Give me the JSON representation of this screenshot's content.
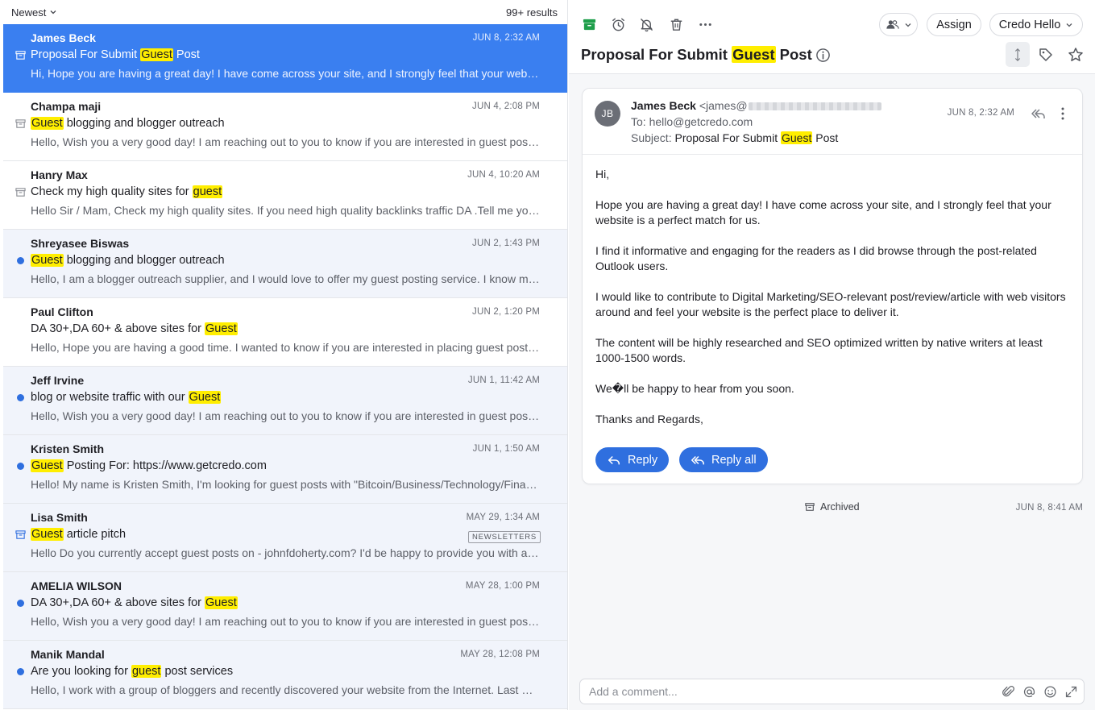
{
  "list": {
    "sort_label": "Newest",
    "results_label": "99+ results",
    "rows": [
      {
        "sender": "James Beck",
        "date": "JUN 8, 2:32 AM",
        "subject_pre": "Proposal For Submit ",
        "subject_hl": "Guest",
        "subject_post": " Post",
        "preview": "Hi, Hope you are having a great day! I have come across your site, and I strongly feel that your website is a perfect match for us.",
        "state": "selected",
        "marker": "archive"
      },
      {
        "sender": "Champa maji",
        "date": "JUN 4, 2:08 PM",
        "subject_pre": "",
        "subject_hl": "Guest",
        "subject_post": " blogging and blogger outreach",
        "preview": "Hello, Wish you a very good day! I am reaching out to you to know if you are interested in guest posting.",
        "state": "read",
        "marker": "archive"
      },
      {
        "sender": "Hanry Max",
        "date": "JUN 4, 10:20 AM",
        "subject_pre": "Check my high quality sites for ",
        "subject_hl": "guest",
        "subject_post": "",
        "preview": "Hello Sir / Mam, Check my high quality sites. If you need high quality backlinks traffic DA .Tell me your budget.",
        "state": "read",
        "marker": "archive"
      },
      {
        "sender": "Shreyasee Biswas",
        "date": "JUN 2, 1:43 PM",
        "subject_pre": "",
        "subject_hl": "Guest",
        "subject_post": " blogging and blogger outreach",
        "preview": "Hello, I am a blogger outreach supplier, and I would love to offer my guest posting service. I know many bloggers.",
        "state": "unread",
        "marker": "dot"
      },
      {
        "sender": "Paul Clifton",
        "date": "JUN 2, 1:20 PM",
        "subject_pre": "DA 30+,DA 60+ & above sites for ",
        "subject_hl": "Guest",
        "subject_post": "",
        "preview": "Hello, Hope you are having a good time. I wanted to know if you are interested in placing guest posts on sites.",
        "state": "read",
        "marker": "none"
      },
      {
        "sender": "Jeff Irvine",
        "date": "JUN 1, 11:42 AM",
        "subject_pre": "blog or website traffic with our ",
        "subject_hl": "Guest",
        "subject_post": "",
        "preview": "Hello, Wish you a very good day! I am reaching out to you to know if you are interested in guest posting.",
        "state": "unread",
        "marker": "dot"
      },
      {
        "sender": "Kristen Smith",
        "date": "JUN 1, 1:50 AM",
        "subject_pre": "",
        "subject_hl": "Guest",
        "subject_post": " Posting For: https://www.getcredo.com",
        "preview": "Hello! My name is Kristen Smith, I'm looking for guest posts with \"Bitcoin/Business/Technology/Finance\" topics.",
        "state": "unread",
        "marker": "dot"
      },
      {
        "sender": "Lisa Smith",
        "date": "MAY 29, 1:34 AM",
        "subject_pre": "",
        "subject_hl": "Guest",
        "subject_post": " article pitch",
        "preview": "Hello Do you currently accept guest posts on - johnfdoherty.com? I'd be happy to provide you with a unique article.",
        "state": "unread",
        "marker": "archive-blue",
        "tag": "NEWSLETTERS"
      },
      {
        "sender": "AMELIA WILSON",
        "date": "MAY 28, 1:00 PM",
        "subject_pre": "DA 30+,DA 60+ & above sites for ",
        "subject_hl": "Guest",
        "subject_post": "",
        "preview": "Hello, Wish you a very good day! I am reaching out to you to know if you are interested in guest posting.",
        "state": "unread",
        "marker": "dot"
      },
      {
        "sender": "Manik Mandal",
        "date": "MAY 28, 12:08 PM",
        "subject_pre": "Are you looking for ",
        "subject_hl": "guest",
        "subject_post": " post services",
        "preview": "Hello, I work with a group of bloggers and recently discovered your website from the Internet. Last week I read it.",
        "state": "unread",
        "marker": "dot"
      }
    ]
  },
  "toolbar": {
    "assign_label": "Assign",
    "inbox_label": "Credo Hello"
  },
  "thread": {
    "title_pre": "Proposal For Submit ",
    "title_hl": "Guest",
    "title_post": " Post"
  },
  "message": {
    "avatar_initials": "JB",
    "from_name": "James Beck",
    "from_addr_prefix": "<james@",
    "to_label": "To:",
    "to_value": "hello@getcredo.com",
    "subject_label": "Subject:",
    "subject_pre": "Proposal For Submit ",
    "subject_hl": "Guest",
    "subject_post": " Post",
    "date": "JUN 8, 2:32 AM",
    "body": [
      "Hi,",
      "Hope you are having a great day! I have come across your site, and I strongly feel that your website is a perfect match for us.",
      "I find it informative and engaging for the readers as I did browse through the post-related Outlook users.",
      "I would like to contribute to Digital Marketing/SEO-relevant post/review/article with web visitors around and feel your website is the perfect place to deliver it.",
      "The content will be highly researched and SEO optimized written by native writers at least 1000-1500 words.",
      "We�ll be happy to hear from you soon.",
      "Thanks and Regards,"
    ],
    "reply_label": "Reply",
    "reply_all_label": "Reply all"
  },
  "archived": {
    "label": "Archived",
    "date": "JUN 8, 8:41 AM"
  },
  "comment": {
    "placeholder": "Add a comment..."
  },
  "colors": {
    "accent": "#2f6fdf",
    "selected_row": "#3a7ff0",
    "highlight": "#ffee00",
    "archive_green": "#1e9e4a"
  }
}
